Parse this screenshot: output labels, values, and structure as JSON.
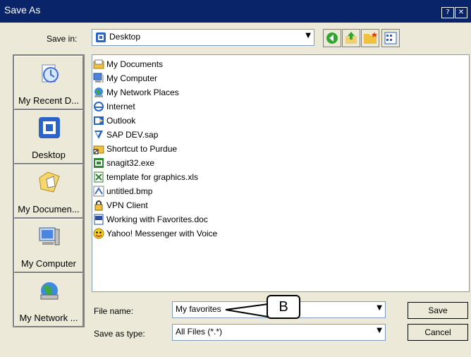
{
  "window": {
    "title": "Save As",
    "help_glyph": "?",
    "close_glyph": "✕"
  },
  "save_in": {
    "label": "Save in:",
    "value": "Desktop"
  },
  "toolbar": {
    "back_icon": "back-arrow-icon",
    "up_icon": "up-folder-icon",
    "new_folder_icon": "new-folder-icon",
    "view_icon": "view-menu-icon"
  },
  "places": [
    {
      "label": "My Recent D...",
      "icon": "recent-documents-icon"
    },
    {
      "label": "Desktop",
      "icon": "desktop-icon"
    },
    {
      "label": "My Documen...",
      "icon": "my-documents-icon"
    },
    {
      "label": "My Computer",
      "icon": "my-computer-icon"
    },
    {
      "label": "My Network ...",
      "icon": "network-places-icon"
    }
  ],
  "files": [
    {
      "name": "My Documents",
      "icon": "folder-icon"
    },
    {
      "name": "My Computer",
      "icon": "computer-icon"
    },
    {
      "name": "My Network Places",
      "icon": "network-icon"
    },
    {
      "name": "Internet",
      "icon": "internet-icon"
    },
    {
      "name": "Outlook",
      "icon": "outlook-icon"
    },
    {
      "name": "SAP DEV.sap",
      "icon": "sap-icon"
    },
    {
      "name": "Shortcut to Purdue",
      "icon": "shortcut-folder-icon"
    },
    {
      "name": "snagit32.exe",
      "icon": "exe-icon"
    },
    {
      "name": "template for graphics.xls",
      "icon": "excel-icon"
    },
    {
      "name": "untitled.bmp",
      "icon": "bitmap-icon"
    },
    {
      "name": "VPN Client",
      "icon": "vpn-icon"
    },
    {
      "name": "Working with Favorites.doc",
      "icon": "word-icon"
    },
    {
      "name": "Yahoo! Messenger with Voice",
      "icon": "yahoo-icon"
    }
  ],
  "filename": {
    "label": "File name:",
    "value": "My favorites"
  },
  "filetype": {
    "label": "Save as type:",
    "value": "All Files (*.*)"
  },
  "buttons": {
    "save": "Save",
    "cancel": "Cancel"
  },
  "callout": {
    "text": "B"
  },
  "colors": {
    "titlebar": "#0a246a",
    "dialog": "#ece9d8",
    "places_panel": "#808080",
    "selection": "#316ac5"
  }
}
